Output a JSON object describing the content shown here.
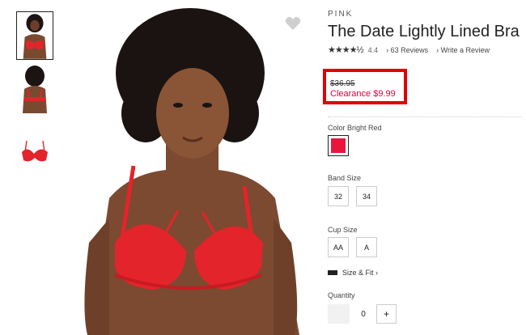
{
  "thumbnails": [
    {
      "name": "front view"
    },
    {
      "name": "back view"
    },
    {
      "name": "product only"
    }
  ],
  "product": {
    "brand": "PINK",
    "title": "The Date Lightly Lined Bra",
    "rating": {
      "stars": "★★★★½",
      "value": "4.4",
      "reviews_label": "63 Reviews",
      "write_label": "Write a Review"
    },
    "price": {
      "original": "$36.95",
      "clearance": "Clearance $9.99"
    },
    "color": {
      "label": "Color Bright Red",
      "swatch": "#e8163c"
    },
    "band_size": {
      "label": "Band Size",
      "options": [
        "32",
        "34"
      ]
    },
    "cup_size": {
      "label": "Cup Size",
      "options": [
        "AA",
        "A"
      ]
    },
    "size_fit": {
      "label": "Size & Fit ›"
    },
    "quantity": {
      "label": "Quantity",
      "value": "0",
      "plus": "+"
    }
  },
  "colors": {
    "highlight": "#e00000",
    "clearance_text": "#e0003a",
    "bra": "#e3242b"
  }
}
